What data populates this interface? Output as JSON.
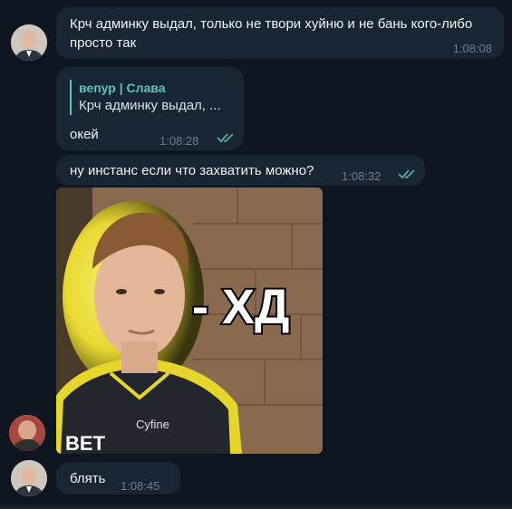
{
  "messages": [
    {
      "text": "Крч админку выдал, только не твори хуйню и не бань кого-либо просто так",
      "time": "1:08:08"
    },
    {
      "reply_name": "вепур | Слава",
      "reply_text": "Крч админку выдал, ...",
      "text": "окей",
      "time": "1:08:28"
    },
    {
      "text": "ну инстанс если что захватить можно?",
      "time": "1:08:32"
    },
    {
      "photo_caption": "- ХД",
      "photo_brand1": "Cyfine",
      "photo_brand2": "BET"
    },
    {
      "text": "блять",
      "time": "1:08:45"
    }
  ],
  "colors": {
    "background": "#0e1621",
    "bubble": "#182533",
    "accent": "#5cc6b4",
    "time": "#6e7f90"
  },
  "icons": {
    "read_receipt": "double-check-icon"
  }
}
